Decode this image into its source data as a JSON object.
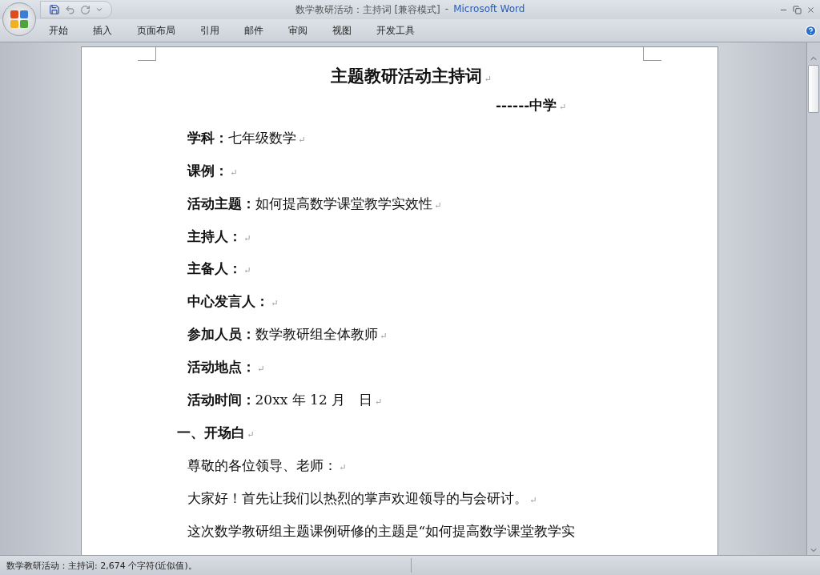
{
  "window": {
    "title": "数学教研活动：主持词 [兼容模式]",
    "separator": "-",
    "app_name": "Microsoft Word"
  },
  "ribbon_tabs": [
    {
      "label": "开始",
      "selected": false
    },
    {
      "label": "插入",
      "selected": false
    },
    {
      "label": "页面布局",
      "selected": false
    },
    {
      "label": "引用",
      "selected": false
    },
    {
      "label": "邮件",
      "selected": false
    },
    {
      "label": "审阅",
      "selected": false
    },
    {
      "label": "视图",
      "selected": false
    },
    {
      "label": "开发工具",
      "selected": false
    }
  ],
  "document": {
    "paragraphs": [
      {
        "kind": "title",
        "text": "主题教研活动主持词",
        "mark": "↵"
      },
      {
        "kind": "subtitle",
        "text": "------中学",
        "mark": "↵"
      },
      {
        "kind": "field",
        "text": "**学科：**七年级数学",
        "mark": "↵"
      },
      {
        "kind": "field",
        "text": "**课例：**",
        "mark": "↵"
      },
      {
        "kind": "field",
        "text": "**活动主题：**如何提高数学课堂教学实效性",
        "mark": "↵"
      },
      {
        "kind": "field",
        "text": "**主持人：**",
        "mark": "↵"
      },
      {
        "kind": "field",
        "text": "**主备人：**",
        "mark": "↵"
      },
      {
        "kind": "field",
        "text": "**中心发言人：**",
        "mark": "↵"
      },
      {
        "kind": "field",
        "text": "**参加人员：**数学教研组全体教师",
        "mark": "↵"
      },
      {
        "kind": "field",
        "text": "**活动地点：**",
        "mark": "↵"
      },
      {
        "kind": "field",
        "text": "**活动时间：**20xx 年 12 月　日",
        "mark": "↵"
      },
      {
        "kind": "heading",
        "text": "一、开场白",
        "mark": "↵"
      },
      {
        "kind": "body",
        "text": "尊敬的各位领导、老师：",
        "mark": "↵"
      },
      {
        "kind": "body",
        "text": "大家好！首先让我们以热烈的掌声欢迎领导的与会研讨。",
        "mark": "↵"
      },
      {
        "kind": "body",
        "text": "这次数学教研组主题课例研修的主题是“如何提高数学课堂教学实"
      }
    ]
  },
  "status_bar": {
    "text": "数学教研活动：主持词: 2,674 个字符(近似值)。"
  }
}
